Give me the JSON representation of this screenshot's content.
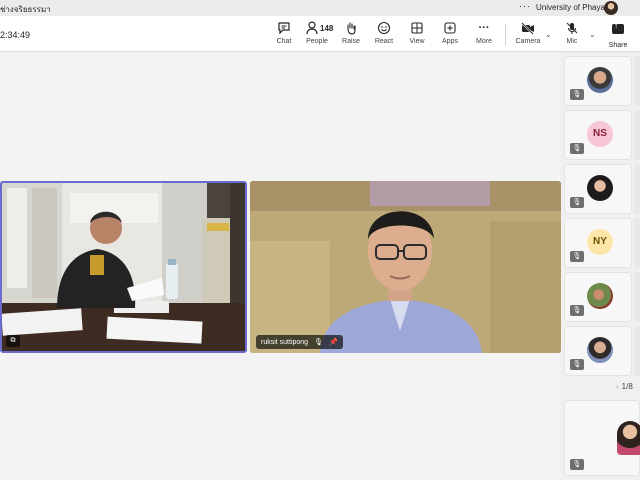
{
  "titlebar": {
    "meeting_title": "ช่างจริยธรรมา",
    "more": "···",
    "org": "University of Phayao"
  },
  "toolbar": {
    "timer": "2:34:49",
    "chat": "Chat",
    "people": "People",
    "people_count": "148",
    "raise": "Raise",
    "react": "React",
    "view": "View",
    "apps": "Apps",
    "more": "More",
    "camera": "Camera",
    "mic": "Mic",
    "share": "Share"
  },
  "tiles": {
    "b_name": "ruksit suttipong"
  },
  "gallery": {
    "items": [
      {
        "kind": "photo"
      },
      {
        "kind": "initials",
        "initials": "NS",
        "color": "#f7c6d4",
        "text_color": "#8a2040"
      },
      {
        "kind": "photo"
      },
      {
        "kind": "initials",
        "initials": "NY",
        "color": "#fbe7a8",
        "text_color": "#6b5205"
      },
      {
        "kind": "photo"
      },
      {
        "kind": "photo"
      }
    ],
    "page": "1/8"
  },
  "colors": {
    "active_border": "#6b6bcf",
    "toolbar_bg": "#ffffff",
    "stage_bg": "#f3f3f3"
  }
}
